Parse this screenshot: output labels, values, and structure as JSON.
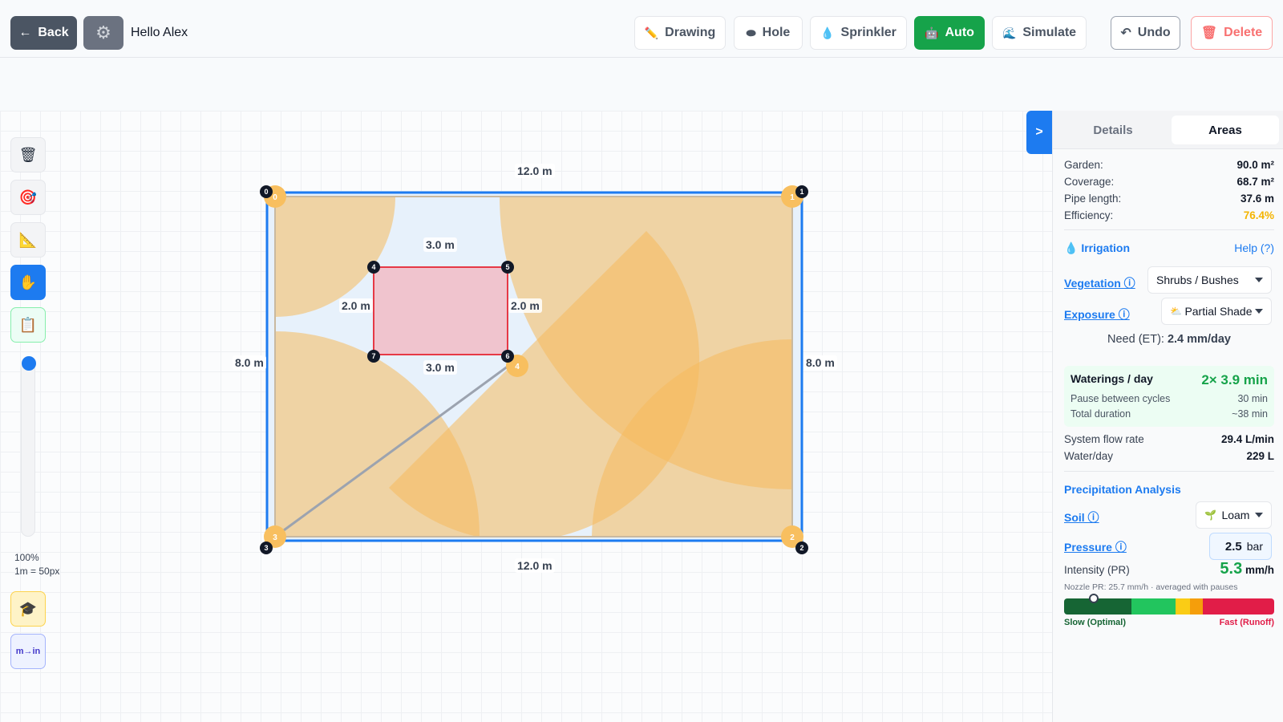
{
  "header": {
    "back_label": "Back",
    "greeting": "Hello Alex",
    "tools": [
      "Drawing",
      "Hole",
      "Sprinkler",
      "Auto",
      "Simulate"
    ],
    "undo_label": "Undo",
    "delete_label": "Delete"
  },
  "canvas": {
    "zoom": "100%",
    "scale": "1m = 50px",
    "unit_toggle": "m→in",
    "dimensions": {
      "top": "12.0 m",
      "bottom": "12.0 m",
      "left": "8.0 m",
      "right": "8.0 m",
      "hole_top": "3.0 m",
      "hole_bottom": "3.0 m",
      "hole_left": "2.0 m",
      "hole_right": "2.0 m"
    },
    "vertices": [
      "0",
      "1",
      "2",
      "3",
      "4",
      "5",
      "6",
      "7"
    ],
    "sprinklers": [
      "0",
      "1",
      "2",
      "3",
      "4"
    ]
  },
  "panel": {
    "toggle": ">",
    "tabs": [
      "Details",
      "Areas"
    ],
    "active_tab": "Areas",
    "stats": [
      {
        "label": "Garden:",
        "value": "90.0 m²"
      },
      {
        "label": "Coverage:",
        "value": "68.7 m²"
      },
      {
        "label": "Pipe length:",
        "value": "37.6 m"
      },
      {
        "label": "Efficiency:",
        "value": "76.4%"
      }
    ],
    "irrigation_title": "Irrigation",
    "help_label": "Help (?)",
    "vegetation_label": "Vegetation ⓘ",
    "vegetation_value": "Shrubs / Bushes",
    "exposure_label": "Exposure ⓘ",
    "exposure_value": "Partial Shade",
    "need_label": "Need (ET):",
    "need_value": "2.4 mm/day",
    "waterings_label": "Waterings / day",
    "waterings_value": "2× 3.9 min",
    "pause_label": "Pause between cycles",
    "pause_value": "30 min",
    "total_label": "Total duration",
    "total_value": "~38 min",
    "flow_label": "System flow rate",
    "flow_value": "29.4 L/min",
    "water_label": "Water/day",
    "water_value": "229 L",
    "precip_title": "Precipitation Analysis",
    "soil_label": "Soil ⓘ",
    "soil_value": "Loam",
    "pressure_label": "Pressure ⓘ",
    "pressure_value": "2.5",
    "pressure_unit": "bar",
    "intensity_label": "Intensity (PR)",
    "intensity_value": "5.3",
    "intensity_unit": "mm/h",
    "nozzle_note": "Nozzle PR: 25.7 mm/h · averaged with pauses",
    "slow_label": "Slow (Optimal)",
    "fast_label": "Fast (Runoff)",
    "intensity_fraction": 0.14
  },
  "colors": {
    "accent": "#1d7bf0",
    "auto_green": "#16a34a",
    "spray": "#f5b95c",
    "hole_fill": "#f0c4ce",
    "hole_stroke": "#e63946",
    "efficiency": "#f4b400"
  }
}
